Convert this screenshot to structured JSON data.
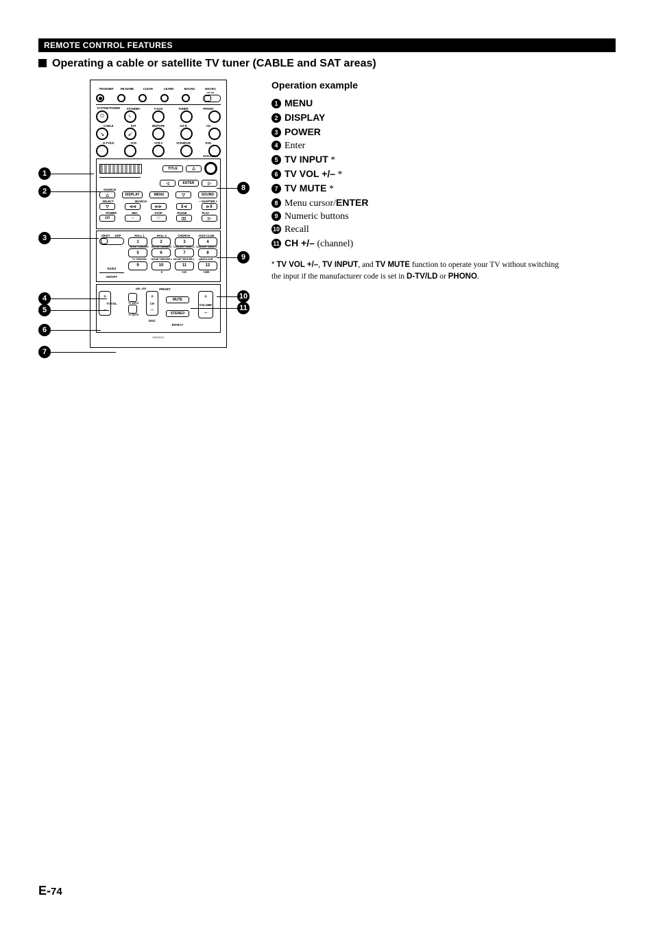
{
  "header": {
    "title": "REMOTE CONTROL FEATURES"
  },
  "section": {
    "title": "Operating a cable or satellite TV tuner (CABLE and SAT areas)"
  },
  "operation_example": {
    "title": "Operation example",
    "items": [
      {
        "n": "1",
        "bold": "MENU",
        "rest": ""
      },
      {
        "n": "2",
        "bold": "DISPLAY",
        "rest": ""
      },
      {
        "n": "3",
        "bold": "POWER",
        "rest": ""
      },
      {
        "n": "4",
        "bold": "",
        "rest": "Enter"
      },
      {
        "n": "5",
        "bold": "TV INPUT",
        "rest": " *"
      },
      {
        "n": "6",
        "bold": "TV VOL +/–",
        "rest": " *"
      },
      {
        "n": "7",
        "bold": "TV MUTE",
        "rest": " *"
      },
      {
        "n": "8",
        "bold_suffix": "ENTER",
        "prefix": "Menu cursor/"
      },
      {
        "n": "9",
        "bold": "",
        "rest": "Numeric buttons"
      },
      {
        "n": "10",
        "bold": "",
        "rest": "Recall"
      },
      {
        "n": "11",
        "bold": "CH +/–",
        "rest": " (channel)"
      }
    ]
  },
  "footnote": {
    "marker": "*",
    "parts": [
      {
        "b": "TV VOL +/–"
      },
      {
        "t": ", "
      },
      {
        "b": "TV INPUT"
      },
      {
        "t": ", and "
      },
      {
        "b": "TV MUTE"
      },
      {
        "t": " function to operate your TV without switching the input if the manufacturer code is set in "
      },
      {
        "b": "D-TV/LD"
      },
      {
        "t": " or "
      },
      {
        "b": "PHONO"
      },
      {
        "t": "."
      }
    ]
  },
  "page_number": {
    "prefix": "E-",
    "num": "74"
  },
  "remote": {
    "top_row": [
      "TRANSMIT",
      "RE-NAME",
      "CLEAR",
      "LEARN",
      "MACRO",
      "MACRO"
    ],
    "macro_sub": "OFF   ON",
    "row2": [
      "SYSTEM POWER",
      "STANDBY",
      "V-AUX",
      "TUNER",
      "PHONO"
    ],
    "row3": [
      "CABLE",
      "SAT",
      "MD/TAPE",
      "CD-R",
      "CD"
    ],
    "row4": [
      "D-TV/LD",
      "VCR",
      "VCR 2",
      "VCR3/DVR",
      "DVD"
    ],
    "ext_input": "6CH INPUT",
    "title": "TITLE",
    "enter": "ENTER",
    "source": "SOURCE",
    "display": "DISPLAY",
    "menu": "MENU",
    "sound": "SOUND",
    "select": "SELECT",
    "search": "SEARCH",
    "chapter": "–   CHAPTER   +",
    "transport_row": [
      "POWER",
      "REC",
      "STOP",
      "PAUSE",
      "PLAY"
    ],
    "dsp_row": {
      "left": [
        "10KEY",
        "DSP"
      ],
      "right_labels": [
        "HALL 1",
        "HALL 2",
        "CHURCH",
        "JAZZ CLUB"
      ]
    },
    "dsp_labels2": [
      "ROCK CONCERT",
      "ENTER-TAINMENT",
      "CONCERT VIDEO 1",
      "CONCERT VIDEO 2"
    ],
    "dsp_labels3": [
      "TV THEATER",
      "MOVIE THEATER 1",
      "MOVIE THEATER 2",
      "q8/9/10/ SUR."
    ],
    "ex_es": "EX/ES",
    "ondoff": "ON/OFF",
    "num_bottom": [
      "0",
      "+10",
      "+100"
    ],
    "bottom": {
      "ab": "A/B/.../E/F",
      "preset": "PRESET",
      "tv_vol": "TV VOL",
      "tv_input": "TV INPUT",
      "tv_mute": "TV MUTE",
      "ch": "CH",
      "mute": "MUTE",
      "stereo": "STEREO",
      "volume": "VOLUME",
      "disc": "DISC",
      "effect": "EFFECT"
    },
    "numbers": [
      "1",
      "2",
      "3",
      "4",
      "5",
      "6",
      "7",
      "8",
      "9",
      "10",
      "11",
      "12"
    ]
  }
}
